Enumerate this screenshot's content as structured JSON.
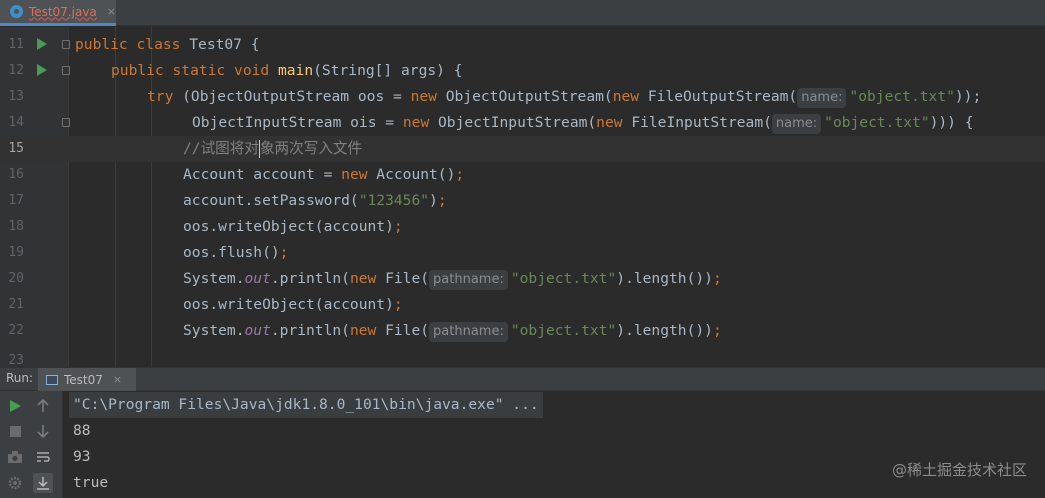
{
  "tab": {
    "filename": "Test07.java",
    "close": "×"
  },
  "editor": {
    "lines": [
      {
        "n": "11"
      },
      {
        "n": "12"
      },
      {
        "n": "13"
      },
      {
        "n": "14"
      },
      {
        "n": "15"
      },
      {
        "n": "16"
      },
      {
        "n": "17"
      },
      {
        "n": "18"
      },
      {
        "n": "19"
      },
      {
        "n": "20"
      },
      {
        "n": "21"
      },
      {
        "n": "22"
      },
      {
        "n": "23"
      }
    ],
    "t": {
      "l11_public": "public",
      "l11_class": "class",
      "l11_name": "Test07",
      "l11_brace": " {",
      "l12_public": "public",
      "l12_static": "static",
      "l12_void": "void",
      "l12_main": "main",
      "l12_args": "(String[] args) {",
      "l13_try": "try",
      "l13_a": " (ObjectOutputStream oos = ",
      "l13_new1": "new",
      "l13_b": " ObjectOutputStream(",
      "l13_new2": "new",
      "l13_c": " FileOutputStream(",
      "l13_hint": "name:",
      "l13_str": "\"object.txt\"",
      "l13_d": "));",
      "l14_a": "ObjectInputStream ois = ",
      "l14_new1": "new",
      "l14_b": " ObjectInputStream(",
      "l14_new2": "new",
      "l14_c": " FileInputStream(",
      "l14_hint": "name:",
      "l14_str": "\"object.txt\"",
      "l14_d": "))) {",
      "l15_a": "//试图将对",
      "l15_b": "象两次写入文件",
      "l16_a": "Account account = ",
      "l16_new": "new",
      "l16_b": " Account()",
      "l16_c": ";",
      "l17_a": "account.setPassword(",
      "l17_str": "\"123456\"",
      "l17_b": ")",
      "l17_c": ";",
      "l18_a": "oos.writeObject(account)",
      "l18_c": ";",
      "l19_a": "oos.flush()",
      "l19_c": ";",
      "l20_a": "System.",
      "l20_out": "out",
      "l20_b": ".println(",
      "l20_new": "new",
      "l20_c": " File(",
      "l20_hint": "pathname:",
      "l20_str": "\"object.txt\"",
      "l20_d": ").length())",
      "l20_e": ";",
      "l21_a": "oos.writeObject(account)",
      "l21_c": ";",
      "l22_a": "System.",
      "l22_out": "out",
      "l22_b": ".println(",
      "l22_new": "new",
      "l22_c": " File(",
      "l22_hint": "pathname:",
      "l22_str": "\"object.txt\"",
      "l22_d": ").length())",
      "l22_e": ";"
    }
  },
  "run": {
    "label": "Run:",
    "tab_label": "Test07",
    "tab_close": "×",
    "output": [
      "\"C:\\Program Files\\Java\\jdk1.8.0_101\\bin\\java.exe\" ...",
      "88",
      "93",
      "true"
    ]
  },
  "watermark": "@稀土掘金技术社区",
  "colors": {
    "keyword": "#cc7832",
    "string": "#6a8759",
    "method": "#ffc66d",
    "comment": "#808080",
    "field": "#9876aa"
  }
}
